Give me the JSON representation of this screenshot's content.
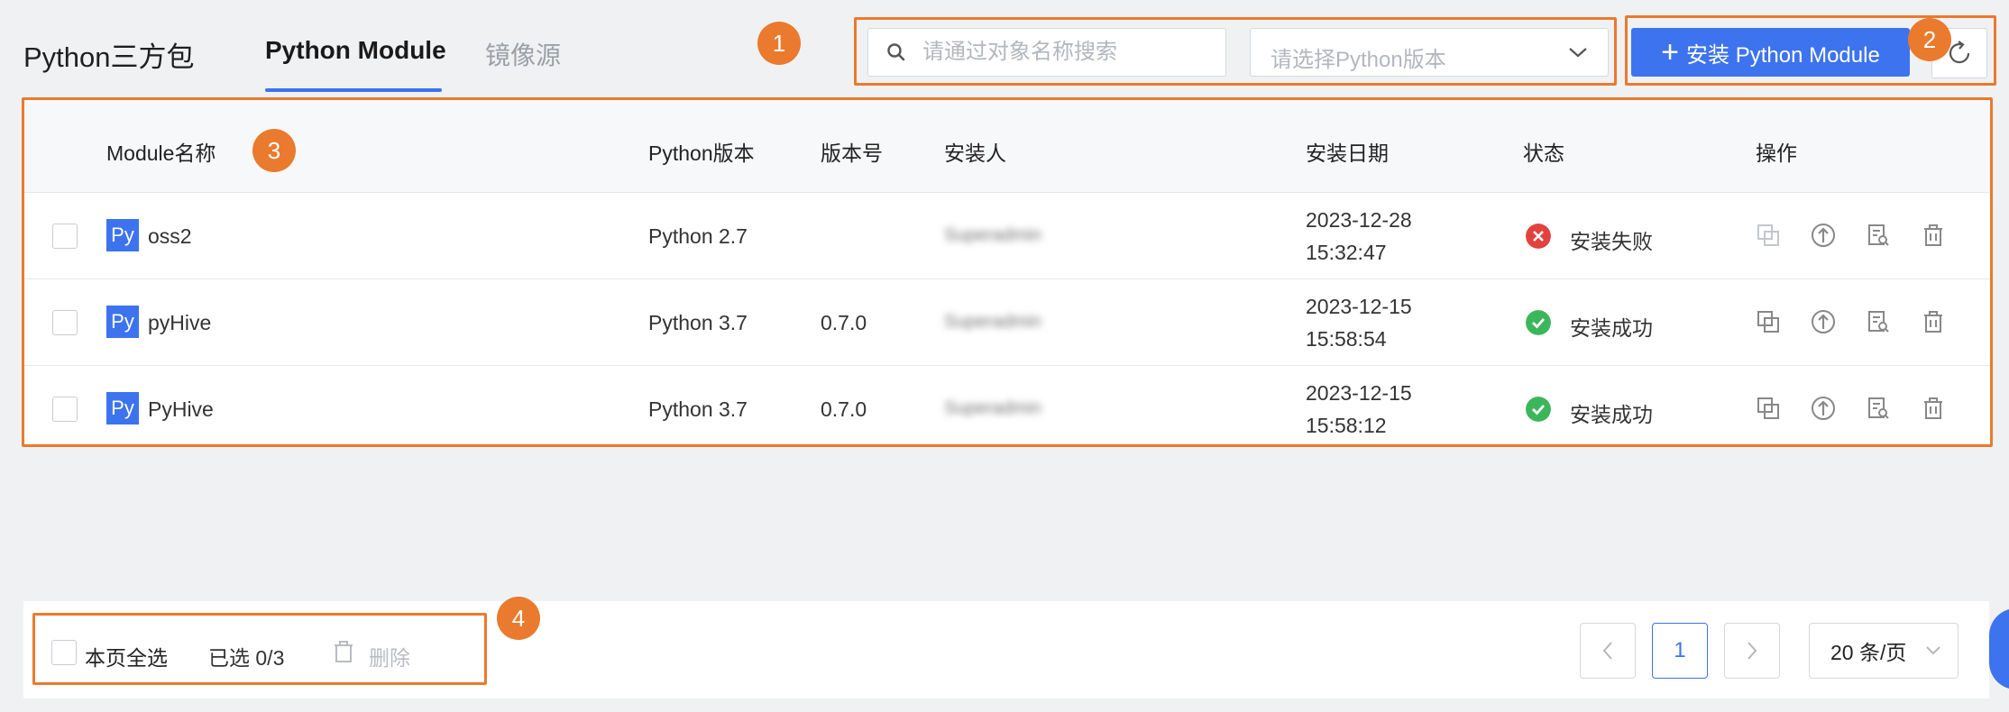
{
  "header": {
    "title": "Python三方包",
    "tabs": [
      {
        "label": "Python Module",
        "active": true
      },
      {
        "label": "镜像源",
        "active": false
      }
    ],
    "search": {
      "placeholder": "请通过对象名称搜索",
      "value": ""
    },
    "version_select": {
      "placeholder": "请选择Python版本"
    },
    "install_button": "安装 Python Module"
  },
  "annotations": [
    "1",
    "2",
    "3",
    "4"
  ],
  "table": {
    "columns": [
      "Module名称",
      "Python版本",
      "版本号",
      "安装人",
      "安装日期",
      "状态",
      "操作"
    ],
    "rows": [
      {
        "name": "oss2",
        "icon_text": "Py",
        "python_version": "Python 2.7",
        "version": "",
        "installer": "Superadmin",
        "date": "2023-12-28",
        "time": "15:32:47",
        "status": "安装失败",
        "status_type": "error"
      },
      {
        "name": "pyHive",
        "icon_text": "Py",
        "python_version": "Python 3.7",
        "version": "0.7.0",
        "installer": "Superadmin",
        "date": "2023-12-15",
        "time": "15:58:54",
        "status": "安装成功",
        "status_type": "success"
      },
      {
        "name": "PyHive",
        "icon_text": "Py",
        "python_version": "Python 3.7",
        "version": "0.7.0",
        "installer": "Superadmin",
        "date": "2023-12-15",
        "time": "15:58:12",
        "status": "安装成功",
        "status_type": "success"
      }
    ]
  },
  "footer": {
    "select_all": "本页全选",
    "selected": "已选 0/3",
    "delete": "删除",
    "current_page": "1",
    "page_size": "20 条/页"
  },
  "colors": {
    "accent": "#3d73ee",
    "annotation": "#ea7a2d",
    "success": "#3cb65a",
    "error": "#e2423f"
  }
}
